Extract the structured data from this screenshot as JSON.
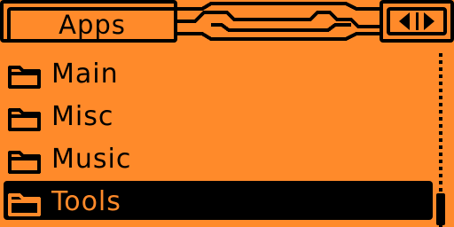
{
  "theme": {
    "background": "#ff8a2a",
    "foreground": "#000000",
    "selected_text": "#ff8a2a"
  },
  "header": {
    "title": "Apps",
    "nav": {
      "prev_icon": "triangle-left-icon",
      "next_icon": "triangle-right-icon"
    }
  },
  "list": {
    "items": [
      {
        "label": "Main",
        "icon": "folder-icon",
        "selected": false
      },
      {
        "label": "Misc",
        "icon": "folder-icon",
        "selected": false
      },
      {
        "label": "Music",
        "icon": "folder-icon",
        "selected": false
      },
      {
        "label": "Tools",
        "icon": "folder-icon",
        "selected": true
      }
    ]
  },
  "scrollbar": {
    "position": 1.0
  }
}
